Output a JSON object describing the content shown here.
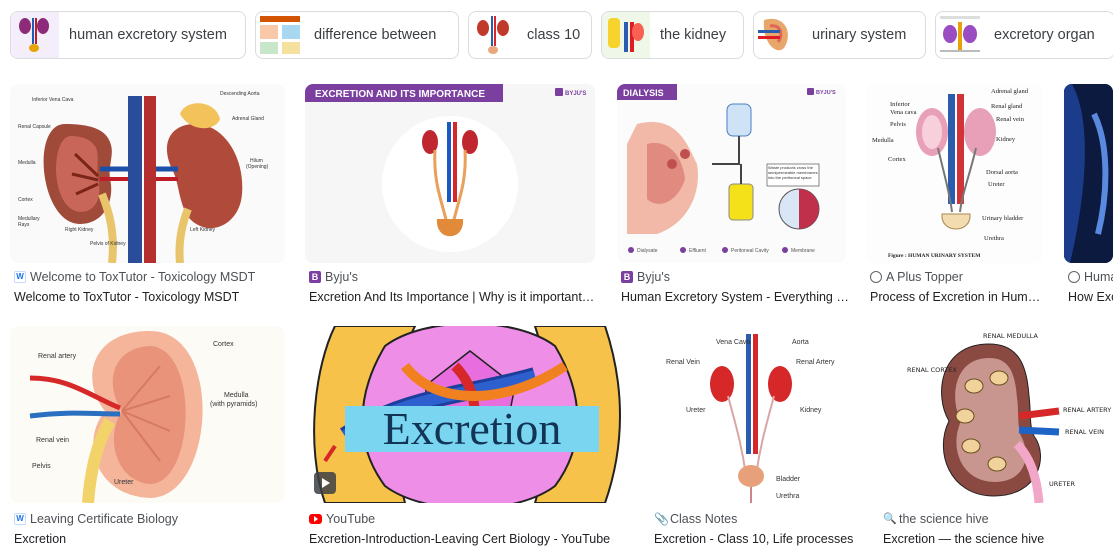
{
  "chips": [
    {
      "label": "human excretory system",
      "thumb_icon": "kidney-diagram-icon"
    },
    {
      "label": "difference between",
      "thumb_icon": "comparison-chart-icon"
    },
    {
      "label": "class 10",
      "thumb_icon": "kidney-diagram-icon"
    },
    {
      "label": "the kidney",
      "thumb_icon": "kidney-diagram-icon"
    },
    {
      "label": "urinary system",
      "thumb_icon": "kidney-diagram-icon"
    },
    {
      "label": "excretory organ",
      "thumb_icon": "excretory-organ-diagram-icon"
    }
  ],
  "row1": [
    {
      "source": "Welcome to ToxTutor - Toxicology MSDT",
      "title": "Welcome to ToxTutor - Toxicology MSDT",
      "favicon": "w-icon",
      "labels": {
        "ivc": "Inferior Vena Cava",
        "aorta": "Descending Aorta",
        "adrenal": "Adrenal Gland",
        "capsule": "Renal Capsule",
        "hilum": "Hilum",
        "hilum_sub": "(Opening)",
        "medulla": "Medulla",
        "cortex": "Cortex",
        "rays": "Medullary",
        "rays2": "Rays",
        "right": "Right Kidney",
        "left": "Left Kidney",
        "pelvis": "Pelvis of Kidney"
      }
    },
    {
      "source": "Byju's",
      "title": "Excretion And Its Importance | Why is it important…",
      "favicon": "byjus-icon",
      "banner": "EXCRETION AND ITS IMPORTANCE",
      "brand": "BYJU'S"
    },
    {
      "source": "Byju's",
      "title": "Human Excretory System - Everything …",
      "favicon": "byjus-icon",
      "banner": "DIALYSIS",
      "brand": "BYJU'S",
      "note": "Waste products cross the semipermeable membranes into the peritoneal space",
      "legend": [
        "Dialysate",
        "Effluent",
        "Peritoneal Cavity",
        "Membrane"
      ]
    },
    {
      "source": "A Plus Topper",
      "title": "Process of Excretion in Hum…",
      "favicon": "globe-icon",
      "labels": {
        "adrenal": "Adrenal gland",
        "ivc": "Inferior",
        "ivc2": "Vena cava",
        "gland": "Renal gland",
        "pelvis": "Pelvis",
        "vein": "Renal vein",
        "medulla": "Medulla",
        "kidney": "Kidney",
        "cortex": "Cortex",
        "dorsal": "Dorsal aorta",
        "ureter": "Ureter",
        "bladder": "Urinary bladder",
        "urethra": "Urethra",
        "caption": "Figure : HUMAN URINARY SYSTEM"
      }
    },
    {
      "source": "Huma",
      "title": "How Exc",
      "favicon": "globe-icon"
    }
  ],
  "row2": [
    {
      "source": "Leaving Certificate Biology",
      "title": "Excretion",
      "favicon": "w-icon",
      "labels": {
        "artery": "Renal artery",
        "cortex": "Cortex",
        "medulla": "Medulla",
        "medulla_sub": "(with pyramids)",
        "vein": "Renal vein",
        "pelvis": "Pelvis",
        "ureter": "Ureter"
      }
    },
    {
      "source": "YouTube",
      "title": "Excretion-Introduction-Leaving Cert Biology - YouTube",
      "favicon": "youtube-icon",
      "overlay_text": "Excretion"
    },
    {
      "source": "Class Notes",
      "title": "Excretion - Class 10, Life processes",
      "favicon": "paperclip-icon",
      "labels": {
        "vena": "Vena Cava",
        "aorta": "Aorta",
        "vein": "Renal Vein",
        "artery": "Renal Artery",
        "ureter": "Ureter",
        "kidney": "Kidney",
        "bladder": "Bladder",
        "urethra": "Urethra"
      }
    },
    {
      "source": "the science hive",
      "title": "Excretion — the science hive",
      "favicon": "search-icon",
      "labels": {
        "medulla": "RENAL MEDULLA",
        "cortex": "RENAL CORTEX",
        "artery": "RENAL ARTERY",
        "vein": "RENAL VEIN",
        "ureter": "URETER"
      }
    }
  ]
}
